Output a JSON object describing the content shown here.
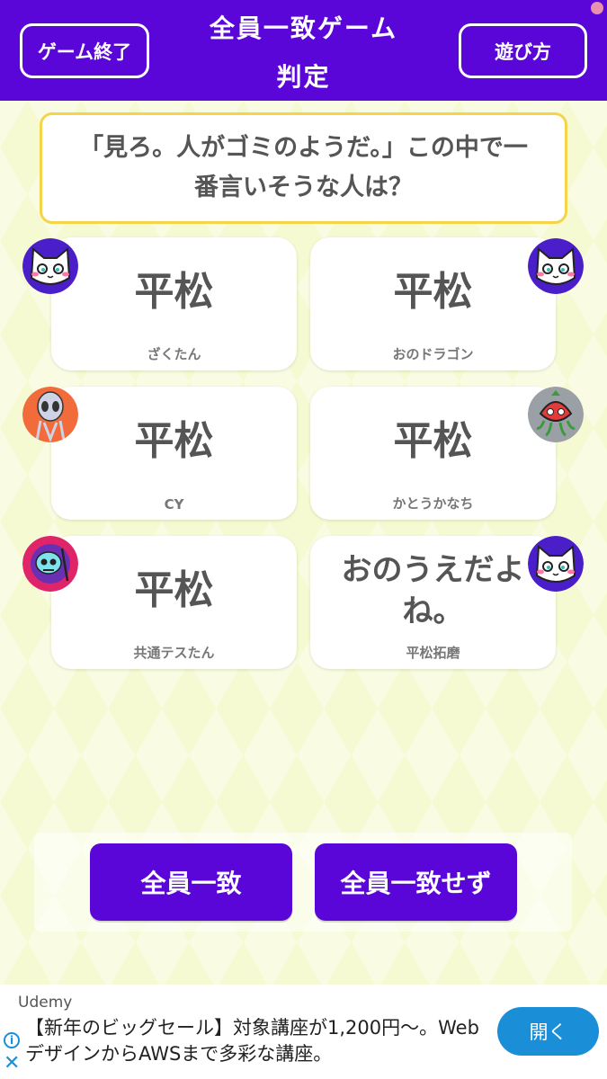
{
  "header": {
    "title_line1": "全員一致ゲーム",
    "title_line2": "判定",
    "end_game_label": "ゲーム終了",
    "how_to_play_label": "遊び方"
  },
  "question": "「見ろ。人がゴミのようだ。」この中で一番言いそうな人は？",
  "answers": [
    {
      "answer": "平松",
      "player": "ざくたん",
      "avatar": "white-cat-icon"
    },
    {
      "answer": "平松",
      "player": "おのドラゴン",
      "avatar": "white-cat-icon"
    },
    {
      "answer": "平松",
      "player": "CY",
      "avatar": "alien-icon"
    },
    {
      "answer": "平松",
      "player": "かとうかなち",
      "avatar": "strawberry-octopus-icon"
    },
    {
      "answer": "平松",
      "player": "共通テスたん",
      "avatar": "skull-reaper-icon"
    },
    {
      "answer": "おのうえだよね。",
      "player": "平松拓磨",
      "avatar": "white-cat-icon"
    }
  ],
  "buttons": {
    "agree": "全員一致",
    "disagree": "全員一致せず"
  },
  "ad": {
    "brand": "Udemy",
    "text": "【新年のビッグセール】対象講座が1,200円～。WebデザインからAWSまで多彩な講座。",
    "open_label": "開く",
    "info_icon": "i",
    "close_icon": "✕"
  },
  "colors": {
    "primary": "#5a06d9",
    "question_border": "#f5d44a",
    "ad_accent": "#1a8fd8"
  }
}
